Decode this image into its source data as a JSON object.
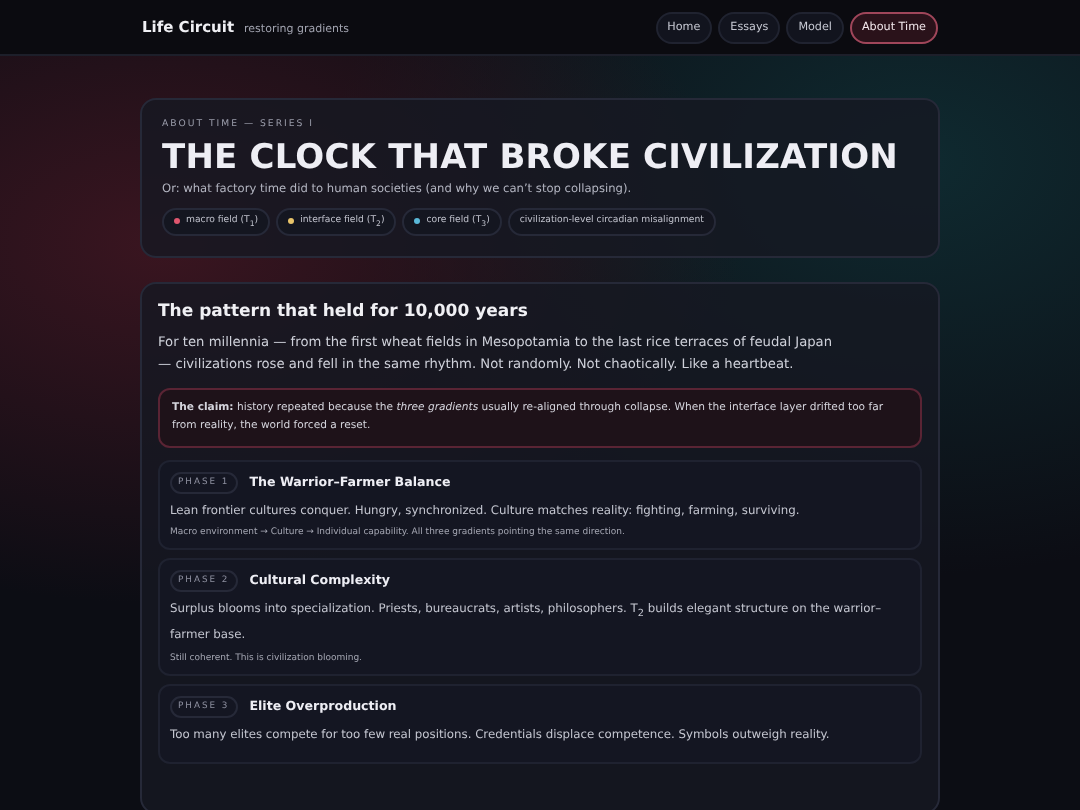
{
  "brand": {
    "name": "Life Circuit",
    "tagline": "restoring gradients"
  },
  "nav": [
    {
      "label": "Home",
      "selected": false
    },
    {
      "label": "Essays",
      "selected": false
    },
    {
      "label": "Model",
      "selected": false
    },
    {
      "label": "About Time",
      "selected": true
    }
  ],
  "hero": {
    "eyebrow": "ABOUT TIME — SERIES I",
    "title": "THE CLOCK THAT BROKE CIVILIZATION",
    "subtitle": "Or: what factory time did to human societies (and why we can’t stop collapsing).",
    "chips": [
      {
        "label": "macro field (T$_{1}$)",
        "color": "#e0566e"
      },
      {
        "label": "interface field (T$_{2}$)",
        "color": "#e8c46a"
      },
      {
        "label": "core field (T$_{3}$)",
        "color": "#5ab8d8"
      },
      {
        "label": "civilization-level circadian misalignment"
      }
    ]
  },
  "section": {
    "heading": "The pattern that held for 10,000 years",
    "body": "For ten millennia — from the first wheat fields in Mesopotamia to the last rice terraces of feudal Japan — civilizations rose and fell in the same rhythm. Not randomly. Not chaotically. Like a heartbeat.",
    "claim": "**The claim:** history repeated because the *three gradients* usually re-aligned through collapse. When the interface layer drifted too far from reality, the world forced a reset.",
    "phases": [
      {
        "tag": "PHASE 1",
        "title": "The Warrior–Farmer Balance",
        "text": "Lean frontier cultures conquer. Hungry, synchronized. Culture matches reality: fighting, farming, surviving.",
        "note": "Macro environment → Culture → Individual capability. All three gradients pointing the same direction."
      },
      {
        "tag": "PHASE 2",
        "title": "Cultural Complexity",
        "text": "Surplus blooms into specialization. Priests, bureaucrats, artists, philosophers. T$_{2}$ builds elegant structure on the warrior–farmer base.",
        "note": "Still coherent. This is civilization blooming."
      },
      {
        "tag": "PHASE 3",
        "title": "Elite Overproduction",
        "text": "Too many elites compete for too few real positions. Credentials displace competence. Symbols outweigh reality."
      }
    ]
  }
}
